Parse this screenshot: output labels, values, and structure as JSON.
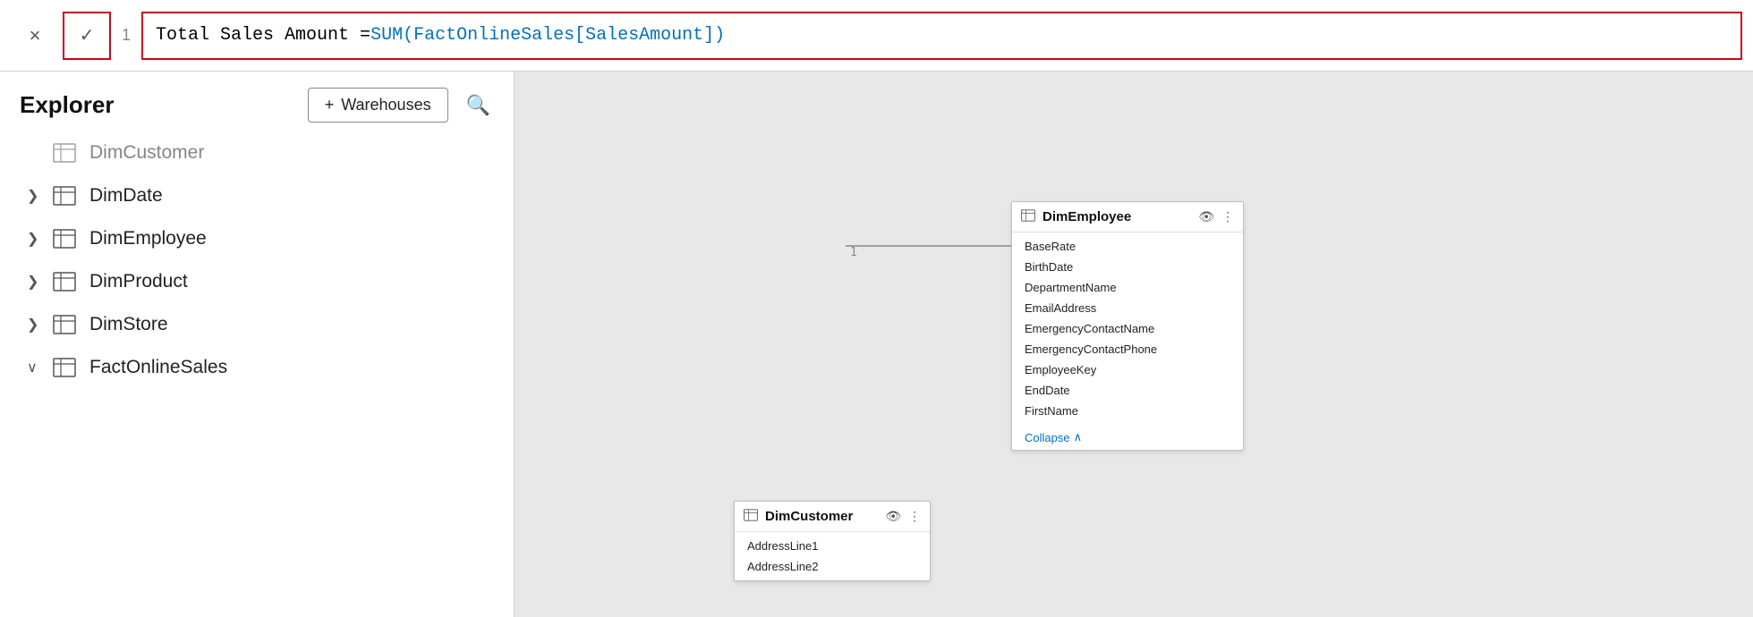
{
  "formulaBar": {
    "cancelLabel": "×",
    "confirmLabel": "✓",
    "lineNumber": "1",
    "formulaBlack": "Total Sales Amount = ",
    "formulaBlue": "SUM(FactOnlineSales[SalesAmount])"
  },
  "sidebar": {
    "title": "Explorer",
    "warehousesLabel": "Warehouses",
    "addIcon": "+",
    "searchIcon": "🔍",
    "items": [
      {
        "label": "DimCustomer",
        "chevron": "",
        "collapsed": true,
        "dimmed": true
      },
      {
        "label": "DimDate",
        "chevron": ">",
        "collapsed": true,
        "dimmed": false
      },
      {
        "label": "DimEmployee",
        "chevron": ">",
        "collapsed": true,
        "dimmed": false
      },
      {
        "label": "DimProduct",
        "chevron": ">",
        "collapsed": true,
        "dimmed": false
      },
      {
        "label": "DimStore",
        "chevron": ">",
        "collapsed": true,
        "dimmed": false
      },
      {
        "label": "FactOnlineSales",
        "chevron": "∨",
        "collapsed": false,
        "dimmed": false
      }
    ]
  },
  "canvas": {
    "dimEmployeeCard": {
      "title": "DimEmployee",
      "fields": [
        "BaseRate",
        "BirthDate",
        "DepartmentName",
        "EmailAddress",
        "EmergencyContactName",
        "EmergencyContactPhone",
        "EmployeeKey",
        "EndDate",
        "FirstName"
      ],
      "collapseLabel": "Collapse"
    },
    "dimCustomerCard": {
      "title": "DimCustomer",
      "fields": [
        "AddressLine1",
        "AddressLine2"
      ]
    }
  }
}
